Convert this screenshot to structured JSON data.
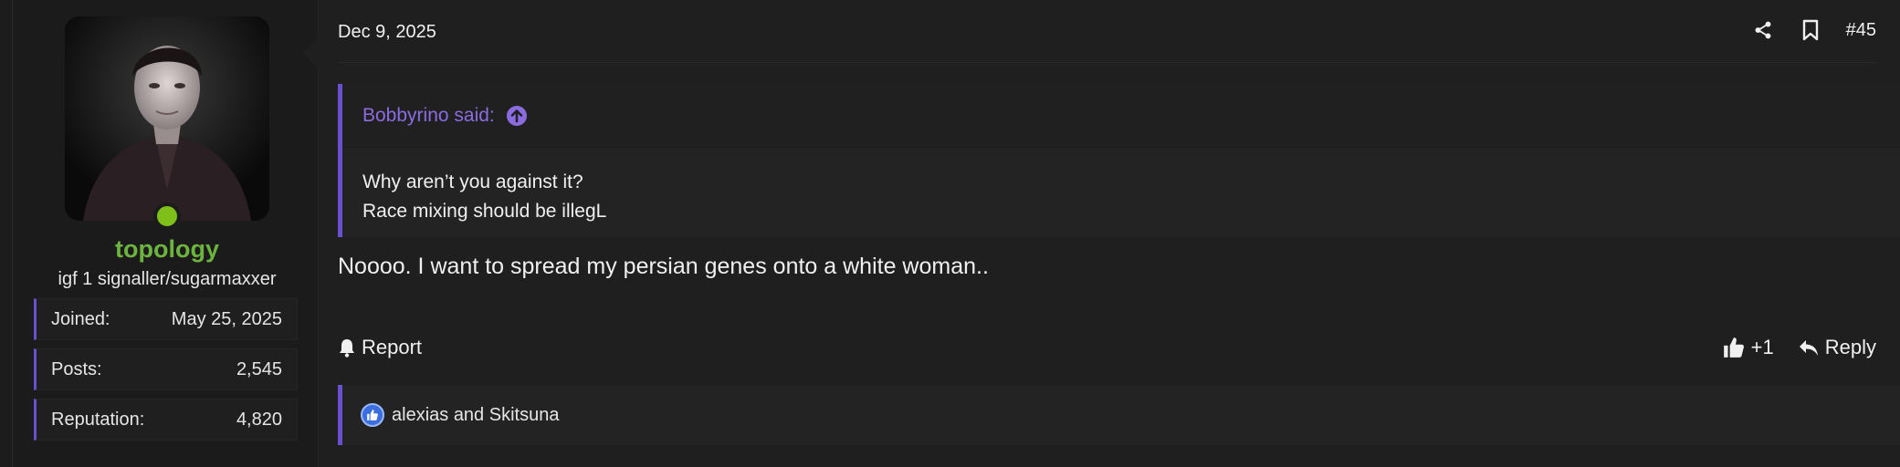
{
  "user": {
    "name": "topology",
    "title": "igf 1 signaller/sugarmaxxer",
    "stats": [
      {
        "label": "Joined:",
        "value": "May 25, 2025"
      },
      {
        "label": "Posts:",
        "value": "2,545"
      },
      {
        "label": "Reputation:",
        "value": "4,820"
      }
    ],
    "online_color": "#7fbf1a"
  },
  "post": {
    "date": "Dec 9, 2025",
    "number": "#45",
    "quote": {
      "author_line": "Bobbyrino said:",
      "lines": [
        "Why aren’t you against it?",
        "Race mixing should be illegL"
      ]
    },
    "message": "Noooo. I want to spread my persian genes onto a white woman..",
    "actions": {
      "report_label": "Report",
      "like_count": "+1",
      "reply_label": "Reply"
    },
    "reactions": {
      "text": "alexias and Skitsuna"
    }
  },
  "icons": {
    "share": "share-icon",
    "bookmark": "bookmark-icon",
    "bell": "bell-icon",
    "thumbs_up": "thumbs-up-icon",
    "reply": "reply-icon",
    "quote_up": "arrow-up-circle-icon"
  },
  "colors": {
    "accent": "#6a4fd0",
    "username": "#6cb33f",
    "quote_author": "#8a6ce0",
    "background": "#1c1c1c"
  }
}
